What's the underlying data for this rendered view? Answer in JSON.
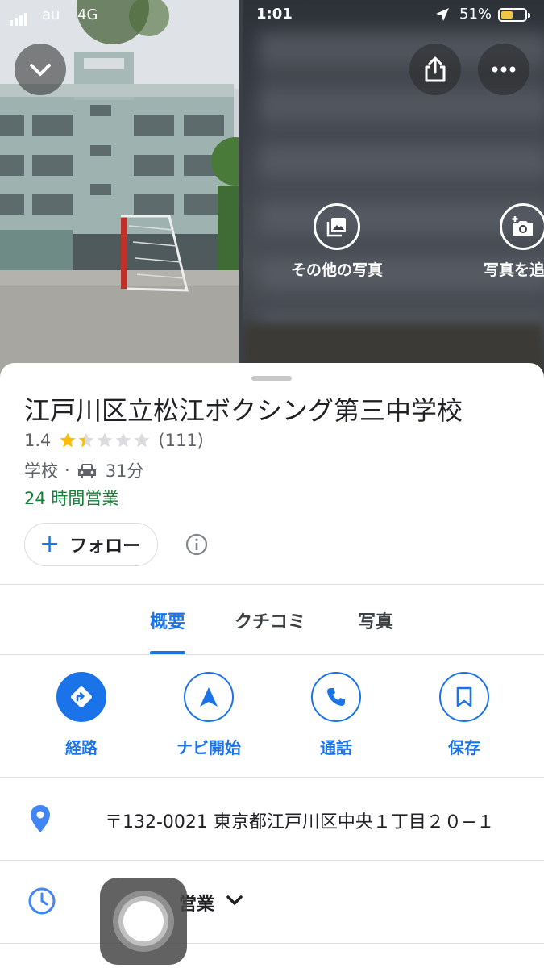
{
  "status_bar": {
    "carrier": "au",
    "network": "4G",
    "time": "1:01",
    "battery_percent": "51%",
    "battery_level": 0.51,
    "battery_color": "#f4c542"
  },
  "photo_header": {
    "collapse_icon": "chevron-down-icon",
    "share_icon": "share-icon",
    "more_icon": "more-horizontal-icon",
    "more_photos_label": "その他の写真",
    "add_photo_label": "写真を追"
  },
  "place": {
    "title": "江戸川区立松江ボクシング第三中学校",
    "rating_value": "1.4",
    "rating_stars": 1.4,
    "review_count": "(111)",
    "category": "学校",
    "separator": "·",
    "drive_time": "31分",
    "hours_status": "24 時間営業",
    "follow_label": "フォロー",
    "follow_plus": "+"
  },
  "tabs": [
    {
      "label": "概要",
      "active": true
    },
    {
      "label": "クチコミ",
      "active": false
    },
    {
      "label": "写真",
      "active": false
    }
  ],
  "actions": [
    {
      "label": "経路",
      "icon": "directions-icon"
    },
    {
      "label": "ナビ開始",
      "icon": "navigation-icon"
    },
    {
      "label": "通話",
      "icon": "phone-icon"
    },
    {
      "label": "保存",
      "icon": "bookmark-icon"
    }
  ],
  "address": {
    "text": "〒132-0021 東京都江戸川区中央１丁目２０−１"
  },
  "hours": {
    "text": "営業"
  },
  "colors": {
    "accent_blue": "#1a73e8",
    "open_green": "#188038",
    "star_gold": "#fbbc04"
  }
}
